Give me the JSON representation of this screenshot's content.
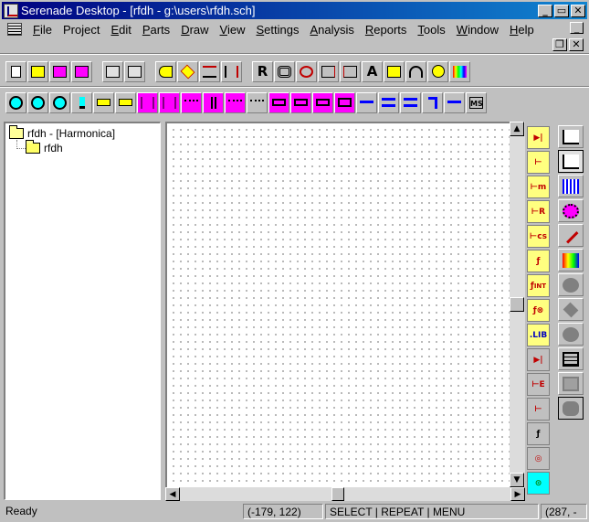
{
  "window": {
    "title": "Serenade Desktop - [rfdh - g:\\users\\rfdh.sch]",
    "minimize": "_",
    "restore": "▭",
    "close": "✕"
  },
  "menu": {
    "items": [
      "File",
      "Project",
      "Edit",
      "Parts",
      "Draw",
      "View",
      "Settings",
      "Analysis",
      "Reports",
      "Tools",
      "Window",
      "Help"
    ],
    "underline": [
      "F",
      "j",
      "E",
      "P",
      "D",
      "V",
      "S",
      "A",
      "R",
      "T",
      "W",
      "H"
    ],
    "mdi_minimize": "_",
    "mdi_restore": "❐",
    "mdi_close": "✕"
  },
  "toolbar1": {
    "resistor_tool": "R",
    "text_tool": "A"
  },
  "tree": {
    "root": "rfdh - [Harmonica]",
    "child": "rfdh"
  },
  "side_palette": {
    "lib_label": ".LIB",
    "int_label": "INT",
    "ms_label": "MS"
  },
  "status": {
    "ready": "Ready",
    "coords": "(-179, 122)",
    "mode": "SELECT   |    REPEAT    |     MENU",
    "coords2": "(287, -"
  },
  "colors": {
    "titlebar_start": "#000080",
    "titlebar_end": "#1084d0",
    "accent_pink": "#ff00ff",
    "palette_yellow": "#ffff80"
  }
}
